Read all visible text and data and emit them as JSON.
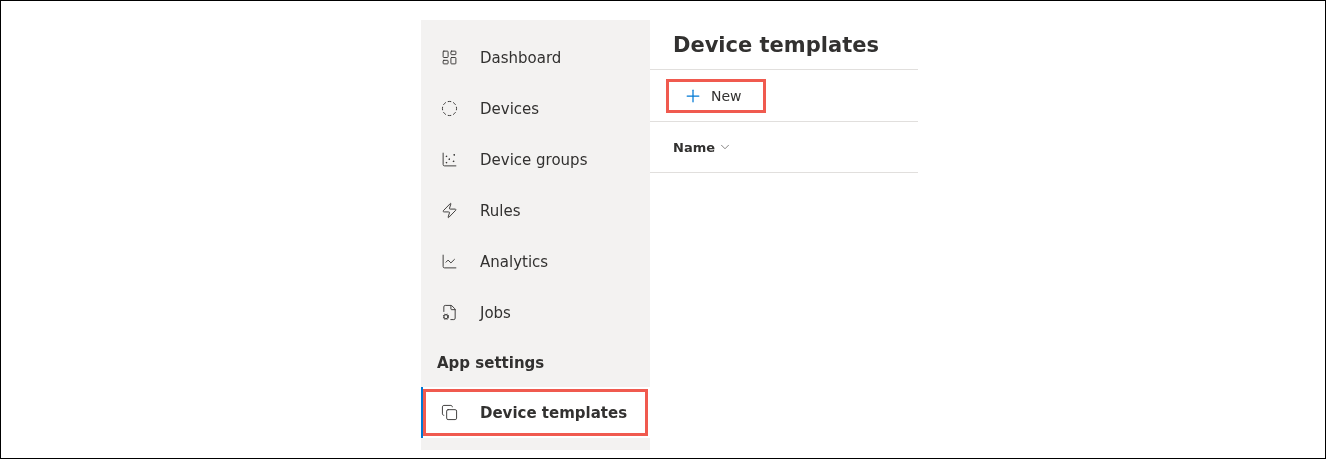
{
  "sidebar": {
    "items": [
      {
        "kind": "nav",
        "label": "Dashboard",
        "selected": false,
        "highlighted": false
      },
      {
        "kind": "nav",
        "label": "Devices",
        "selected": false,
        "highlighted": false
      },
      {
        "kind": "nav",
        "label": "Device groups",
        "selected": false,
        "highlighted": false
      },
      {
        "kind": "nav",
        "label": "Rules",
        "selected": false,
        "highlighted": false
      },
      {
        "kind": "nav",
        "label": "Analytics",
        "selected": false,
        "highlighted": false
      },
      {
        "kind": "nav",
        "label": "Jobs",
        "selected": false,
        "highlighted": false
      },
      {
        "kind": "header",
        "label": "App settings"
      },
      {
        "kind": "nav",
        "label": "Device templates",
        "selected": true,
        "highlighted": true
      }
    ]
  },
  "page": {
    "title": "Device templates",
    "new_button": {
      "label": "New",
      "highlighted": true
    },
    "columns": [
      {
        "label": "Name"
      }
    ]
  }
}
